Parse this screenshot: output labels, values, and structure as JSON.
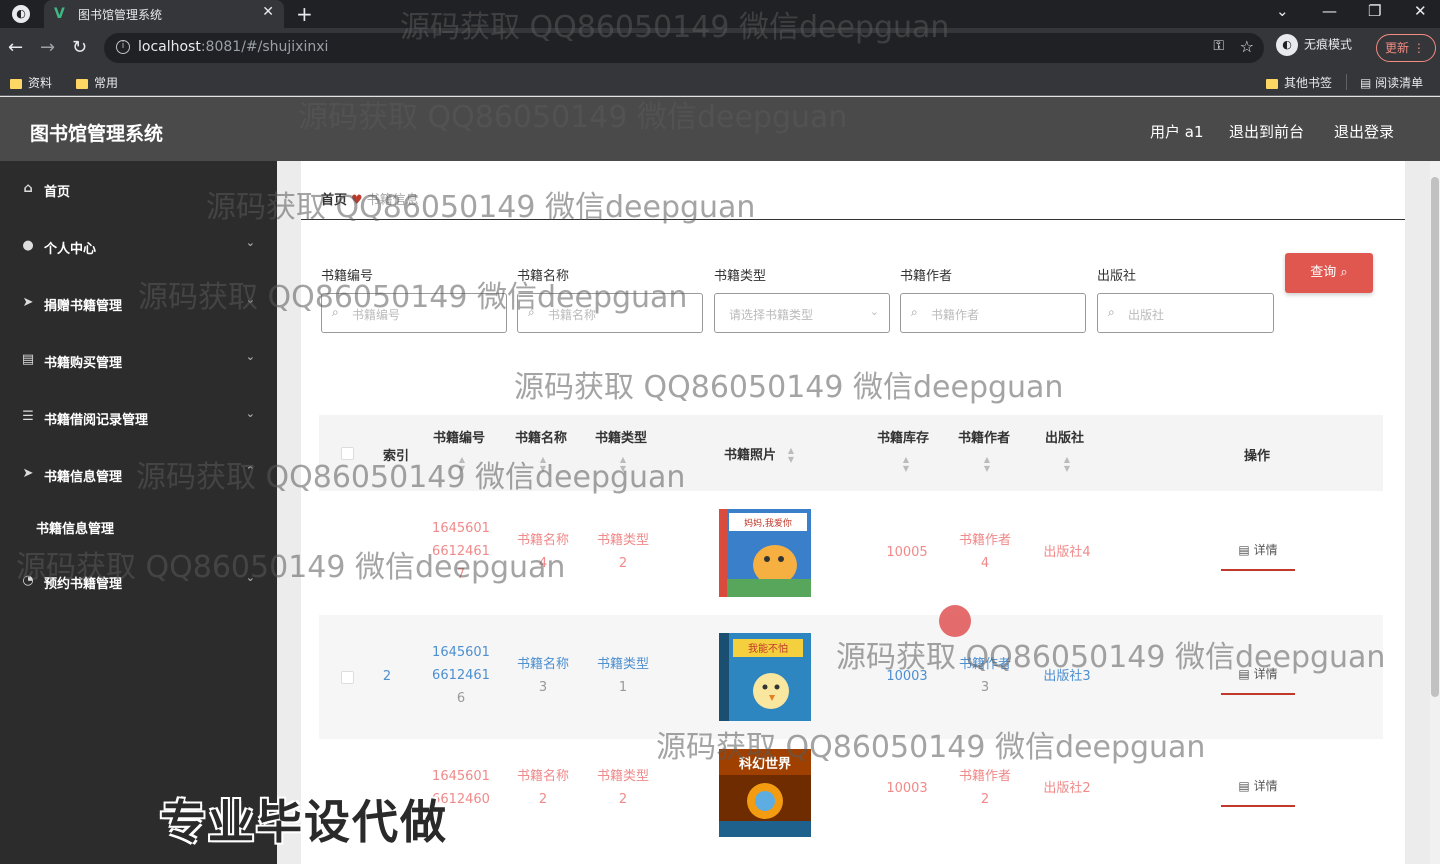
{
  "browser": {
    "tab_title": "图书馆管理系统",
    "url_host": "localhost",
    "url_path": ":8081/#/shujixinxi",
    "profile_label": "无痕模式",
    "update_label": "更新",
    "bookmarks": [
      "资料",
      "常用"
    ],
    "bookmarks_right": [
      "其他书签",
      "阅读清单"
    ]
  },
  "app": {
    "title": "图书馆管理系统",
    "header_links": [
      "用户 a1",
      "退出到前台",
      "退出登录"
    ]
  },
  "sidebar": {
    "items": [
      {
        "label": "首页",
        "icon": "home-icon"
      },
      {
        "label": "个人中心",
        "icon": "user-icon"
      },
      {
        "label": "捐赠书籍管理",
        "icon": "send-icon"
      },
      {
        "label": "书籍购买管理",
        "icon": "document-icon"
      },
      {
        "label": "书籍借阅记录管理",
        "icon": "list-icon"
      },
      {
        "label": "书籍信息管理",
        "icon": "send-icon"
      },
      {
        "label": "书籍信息管理"
      },
      {
        "label": "预约书籍管理",
        "icon": "bell-icon"
      }
    ]
  },
  "breadcrumb": {
    "home": "首页",
    "current": "书籍信息"
  },
  "search": {
    "fields": [
      {
        "label": "书籍编号",
        "placeholder": "书籍编号"
      },
      {
        "label": "书籍名称",
        "placeholder": "书籍名称"
      },
      {
        "label": "书籍类型",
        "placeholder": "请选择书籍类型"
      },
      {
        "label": "书籍作者",
        "placeholder": "书籍作者"
      },
      {
        "label": "出版社",
        "placeholder": "出版社"
      }
    ],
    "query_label": "查询"
  },
  "table": {
    "headers": {
      "index": "索引",
      "code": "书籍编号",
      "name": "书籍名称",
      "type": "书籍类型",
      "photo": "书籍照片",
      "stock": "书籍库存",
      "author": "书籍作者",
      "publisher": "出版社",
      "action": "操作"
    },
    "detail_label": "详情",
    "rows": [
      {
        "index": "",
        "code1": "1645601",
        "code2": "6612461",
        "code3": "7",
        "name1": "书籍名称",
        "name2": "4",
        "type1": "书籍类型",
        "type2": "2",
        "stock": "10005",
        "author1": "书籍作者",
        "author2": "4",
        "publisher": "出版社4",
        "cover_text": "妈妈,我爱你"
      },
      {
        "index": "2",
        "code1": "1645601",
        "code2": "6612461",
        "code3": "6",
        "name1": "书籍名称",
        "name2": "3",
        "type1": "书籍类型",
        "type2": "1",
        "stock": "10003",
        "author1": "书籍作者",
        "author2": "3",
        "publisher": "出版社3",
        "cover_text": "我能不怕"
      },
      {
        "index": "",
        "code1": "1645601",
        "code2": "6612460",
        "code3": "",
        "name1": "书籍名称",
        "name2": "2",
        "type1": "书籍类型",
        "type2": "2",
        "stock": "10003",
        "author1": "书籍作者",
        "author2": "2",
        "publisher": "出版社2",
        "cover_text": "科幻世界"
      }
    ]
  },
  "overlay": {
    "watermark": "源码获取 QQ86050149 微信deepguan",
    "promo": "专业毕设代做"
  },
  "colors": {
    "accent": "#e0574f",
    "sidebar_bg": "#2c2c2c",
    "header_bg": "#4a4a4a"
  }
}
